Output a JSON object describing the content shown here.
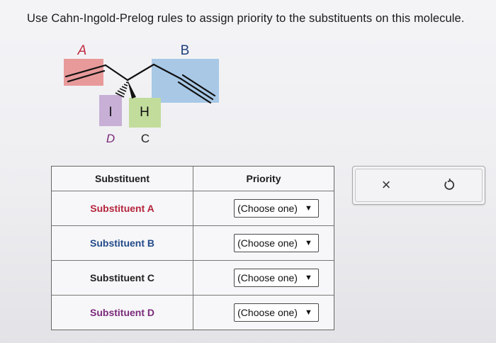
{
  "question": "Use Cahn-Ingold-Prelog rules to assign priority to the substituents on this molecule.",
  "molecule": {
    "labels": {
      "a": "A",
      "b": "B",
      "c": "C",
      "d": "D"
    },
    "atoms": {
      "iodine": "I",
      "hydrogen": "H"
    },
    "colors": {
      "a": "#e89a9a",
      "b": "#a8c8e6",
      "c": "#c2dc9c",
      "d": "#c7afd6"
    }
  },
  "table": {
    "headers": {
      "substituent": "Substituent",
      "priority": "Priority"
    },
    "rows": [
      {
        "label": "Substituent A",
        "color": "#b5253d",
        "selection": "(Choose one)"
      },
      {
        "label": "Substituent B",
        "color": "#234a8a",
        "selection": "(Choose one)"
      },
      {
        "label": "Substituent C",
        "color": "#222222",
        "selection": "(Choose one)"
      },
      {
        "label": "Substituent D",
        "color": "#7a2a7a",
        "selection": "(Choose one)"
      }
    ]
  },
  "actions": {
    "clear_icon": "x-icon",
    "undo_icon": "undo-icon",
    "clear_symbol": "×"
  }
}
